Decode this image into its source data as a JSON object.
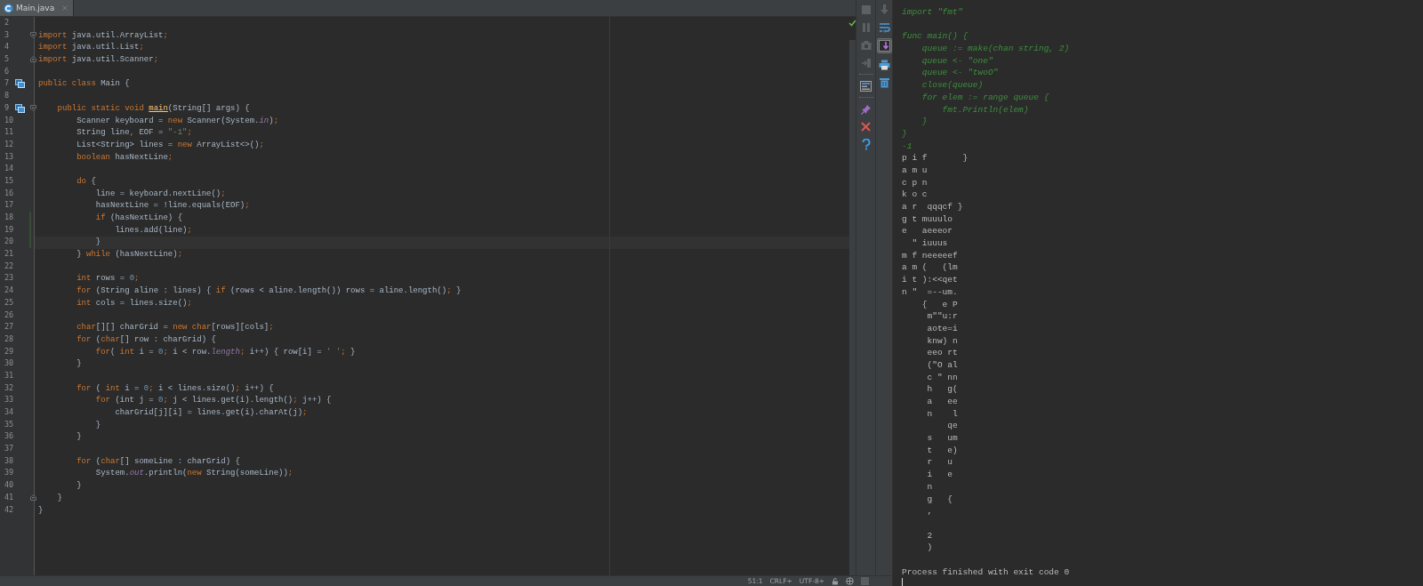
{
  "editor": {
    "tabs": [
      {
        "label": "Main.java",
        "selected": true
      }
    ],
    "inspection_ok": true,
    "lines": [
      {
        "number": "2"
      },
      {
        "number": "3",
        "fold_start": true,
        "tokens": [
          {
            "kind": "keyword",
            "text": "import"
          },
          {
            "kind": "plain",
            "text": " java.util.ArrayList"
          },
          {
            "kind": "punct",
            "text": ";"
          }
        ]
      },
      {
        "number": "4",
        "tokens": [
          {
            "kind": "keyword",
            "text": "import"
          },
          {
            "kind": "plain",
            "text": " java.util.List"
          },
          {
            "kind": "punct",
            "text": ";"
          }
        ]
      },
      {
        "number": "5",
        "fold_end": true,
        "tokens": [
          {
            "kind": "keyword",
            "text": "import"
          },
          {
            "kind": "plain",
            "text": " java.util.Scanner"
          },
          {
            "kind": "punct",
            "text": ";"
          }
        ]
      },
      {
        "number": "6"
      },
      {
        "number": "7",
        "has_implementations": true,
        "tokens": [
          {
            "kind": "keyword",
            "text": "public class"
          },
          {
            "kind": "plain",
            "text": " Main {"
          }
        ]
      },
      {
        "number": "8"
      },
      {
        "number": "9",
        "has_implementations": true,
        "fold_start": true,
        "tokens": [
          {
            "kind": "keyword",
            "text": "    public static void "
          },
          {
            "kind": "method",
            "text": "main"
          },
          {
            "kind": "plain",
            "text": "(String[] args) {"
          }
        ]
      },
      {
        "number": "10",
        "tokens": [
          {
            "kind": "plain",
            "text": "        Scanner keyboard = "
          },
          {
            "kind": "keyword",
            "text": "new"
          },
          {
            "kind": "plain",
            "text": " Scanner(System."
          },
          {
            "kind": "field",
            "text": "in"
          },
          {
            "kind": "plain",
            "text": ")"
          },
          {
            "kind": "punct",
            "text": ";"
          }
        ]
      },
      {
        "number": "11",
        "tokens": [
          {
            "kind": "plain",
            "text": "        String line"
          },
          {
            "kind": "punct",
            "text": ","
          },
          {
            "kind": "plain",
            "text": " EOF = "
          },
          {
            "kind": "string",
            "text": "\"-1\""
          },
          {
            "kind": "punct",
            "text": ";"
          }
        ]
      },
      {
        "number": "12",
        "tokens": [
          {
            "kind": "plain",
            "text": "        List<String> lines = "
          },
          {
            "kind": "keyword",
            "text": "new"
          },
          {
            "kind": "plain",
            "text": " ArrayList<>()"
          },
          {
            "kind": "punct",
            "text": ";"
          }
        ]
      },
      {
        "number": "13",
        "tokens": [
          {
            "kind": "keyword",
            "text": "        boolean"
          },
          {
            "kind": "plain",
            "text": " hasNextLine"
          },
          {
            "kind": "punct",
            "text": ";"
          }
        ]
      },
      {
        "number": "14"
      },
      {
        "number": "15",
        "tokens": [
          {
            "kind": "keyword",
            "text": "        do"
          },
          {
            "kind": "plain",
            "text": " {"
          }
        ]
      },
      {
        "number": "16",
        "tokens": [
          {
            "kind": "plain",
            "text": "            line = keyboard.nextLine()"
          },
          {
            "kind": "punct",
            "text": ";"
          }
        ]
      },
      {
        "number": "17",
        "tokens": [
          {
            "kind": "plain",
            "text": "            hasNextLine = !line.equals(EOF)"
          },
          {
            "kind": "punct",
            "text": ";"
          }
        ]
      },
      {
        "number": "18",
        "changed": true,
        "tokens": [
          {
            "kind": "keyword",
            "text": "            if"
          },
          {
            "kind": "plain",
            "text": " (hasNextLine) {"
          }
        ]
      },
      {
        "number": "19",
        "changed": true,
        "tokens": [
          {
            "kind": "plain",
            "text": "                lines.add(line)"
          },
          {
            "kind": "punct",
            "text": ";"
          }
        ]
      },
      {
        "number": "20",
        "changed": true,
        "current": true,
        "tokens": [
          {
            "kind": "plain",
            "text": "            }"
          }
        ]
      },
      {
        "number": "21",
        "tokens": [
          {
            "kind": "plain",
            "text": "        } "
          },
          {
            "kind": "keyword",
            "text": "while"
          },
          {
            "kind": "plain",
            "text": " (hasNextLine)"
          },
          {
            "kind": "punct",
            "text": ";"
          }
        ]
      },
      {
        "number": "22"
      },
      {
        "number": "23",
        "tokens": [
          {
            "kind": "keyword",
            "text": "        int"
          },
          {
            "kind": "plain",
            "text": " rows = "
          },
          {
            "kind": "number",
            "text": "0"
          },
          {
            "kind": "punct",
            "text": ";"
          }
        ]
      },
      {
        "number": "24",
        "tokens": [
          {
            "kind": "keyword",
            "text": "        for"
          },
          {
            "kind": "plain",
            "text": " (String aline : lines) { "
          },
          {
            "kind": "keyword",
            "text": "if"
          },
          {
            "kind": "plain",
            "text": " (rows < aline.length()) rows = aline.length()"
          },
          {
            "kind": "punct",
            "text": ";"
          },
          {
            "kind": "plain",
            "text": " }"
          }
        ]
      },
      {
        "number": "25",
        "tokens": [
          {
            "kind": "keyword",
            "text": "        int"
          },
          {
            "kind": "plain",
            "text": " cols = lines.size()"
          },
          {
            "kind": "punct",
            "text": ";"
          }
        ]
      },
      {
        "number": "26"
      },
      {
        "number": "27",
        "tokens": [
          {
            "kind": "keyword",
            "text": "        char"
          },
          {
            "kind": "plain",
            "text": "[][] charGrid = "
          },
          {
            "kind": "keyword",
            "text": "new char"
          },
          {
            "kind": "plain",
            "text": "[rows][cols]"
          },
          {
            "kind": "punct",
            "text": ";"
          }
        ]
      },
      {
        "number": "28",
        "tokens": [
          {
            "kind": "keyword",
            "text": "        for"
          },
          {
            "kind": "plain",
            "text": " ("
          },
          {
            "kind": "keyword",
            "text": "char"
          },
          {
            "kind": "plain",
            "text": "[] row : charGrid) {"
          }
        ]
      },
      {
        "number": "29",
        "tokens": [
          {
            "kind": "keyword",
            "text": "            for"
          },
          {
            "kind": "plain",
            "text": "( "
          },
          {
            "kind": "keyword",
            "text": "int"
          },
          {
            "kind": "plain",
            "text": " i = "
          },
          {
            "kind": "number",
            "text": "0"
          },
          {
            "kind": "punct",
            "text": ";"
          },
          {
            "kind": "plain",
            "text": " i < row."
          },
          {
            "kind": "field",
            "text": "length"
          },
          {
            "kind": "punct",
            "text": ";"
          },
          {
            "kind": "plain",
            "text": " i++) { row[i] = "
          },
          {
            "kind": "string",
            "text": "' '"
          },
          {
            "kind": "punct",
            "text": ";"
          },
          {
            "kind": "plain",
            "text": " }"
          }
        ]
      },
      {
        "number": "30",
        "tokens": [
          {
            "kind": "plain",
            "text": "        }"
          }
        ]
      },
      {
        "number": "31"
      },
      {
        "number": "32",
        "tokens": [
          {
            "kind": "keyword",
            "text": "        for"
          },
          {
            "kind": "plain",
            "text": " ( "
          },
          {
            "kind": "keyword",
            "text": "int"
          },
          {
            "kind": "plain",
            "text": " i = "
          },
          {
            "kind": "number",
            "text": "0"
          },
          {
            "kind": "punct",
            "text": ";"
          },
          {
            "kind": "plain",
            "text": " i < lines.size()"
          },
          {
            "kind": "punct",
            "text": ";"
          },
          {
            "kind": "plain",
            "text": " i++) {"
          }
        ]
      },
      {
        "number": "33",
        "tokens": [
          {
            "kind": "keyword",
            "text": "            for"
          },
          {
            "kind": "plain",
            "text": " (int j = "
          },
          {
            "kind": "number",
            "text": "0"
          },
          {
            "kind": "punct",
            "text": ";"
          },
          {
            "kind": "plain",
            "text": " j < lines.get(i).length()"
          },
          {
            "kind": "punct",
            "text": ";"
          },
          {
            "kind": "plain",
            "text": " j++) {"
          }
        ]
      },
      {
        "number": "34",
        "tokens": [
          {
            "kind": "plain",
            "text": "                charGrid[j][i] = lines.get(i).charAt(j)"
          },
          {
            "kind": "punct",
            "text": ";"
          }
        ]
      },
      {
        "number": "35",
        "tokens": [
          {
            "kind": "plain",
            "text": "            }"
          }
        ]
      },
      {
        "number": "36",
        "tokens": [
          {
            "kind": "plain",
            "text": "        }"
          }
        ]
      },
      {
        "number": "37"
      },
      {
        "number": "38",
        "tokens": [
          {
            "kind": "keyword",
            "text": "        for"
          },
          {
            "kind": "plain",
            "text": " ("
          },
          {
            "kind": "keyword",
            "text": "char"
          },
          {
            "kind": "plain",
            "text": "[] someLine : charGrid) {"
          }
        ]
      },
      {
        "number": "39",
        "tokens": [
          {
            "kind": "plain",
            "text": "            System."
          },
          {
            "kind": "field",
            "text": "out"
          },
          {
            "kind": "plain",
            "text": ".println("
          },
          {
            "kind": "keyword",
            "text": "new"
          },
          {
            "kind": "plain",
            "text": " String(someLine))"
          },
          {
            "kind": "punct",
            "text": ";"
          }
        ]
      },
      {
        "number": "40",
        "tokens": [
          {
            "kind": "plain",
            "text": "        }"
          }
        ]
      },
      {
        "number": "41",
        "fold_end": true,
        "tokens": [
          {
            "kind": "plain",
            "text": "    }"
          }
        ]
      },
      {
        "number": "42",
        "tokens": [
          {
            "kind": "plain",
            "text": "}"
          }
        ]
      }
    ]
  },
  "tool_strips": [
    {
      "buttons": [
        {
          "kind": "stop",
          "disabled": true
        },
        {
          "kind": "pause",
          "disabled": true
        },
        {
          "kind": "camera",
          "disabled": true
        },
        {
          "kind": "login",
          "disabled": true
        },
        {
          "kind": "separator"
        },
        {
          "kind": "layout",
          "disabled": false
        },
        {
          "kind": "separator"
        },
        {
          "kind": "pin",
          "disabled": false
        },
        {
          "kind": "close",
          "disabled": false
        },
        {
          "kind": "help",
          "disabled": false
        }
      ]
    },
    {
      "buttons": [
        {
          "kind": "down",
          "disabled": true,
          "selected": false
        },
        {
          "kind": "wrap",
          "disabled": false,
          "selected": false
        },
        {
          "kind": "scroll-end",
          "disabled": false,
          "selected": true
        },
        {
          "kind": "print",
          "disabled": false,
          "selected": false
        },
        {
          "kind": "trash",
          "disabled": false,
          "selected": false
        }
      ]
    }
  ],
  "status_bar": {
    "position": "51:1",
    "line_separator": "CRLF÷",
    "encoding": "UTF-8÷"
  },
  "console": {
    "caret": true,
    "lines": [
      {
        "kind": "echo",
        "text": "import \"fmt\""
      },
      {
        "kind": "blank"
      },
      {
        "kind": "echo",
        "text": "func main() {"
      },
      {
        "kind": "echo",
        "text": "    queue := make(chan string, 2)"
      },
      {
        "kind": "echo",
        "text": "    queue <- \"one\""
      },
      {
        "kind": "echo",
        "text": "    queue <- \"twoO\""
      },
      {
        "kind": "echo",
        "text": "    close(queue)"
      },
      {
        "kind": "echo",
        "text": "    for elem := range queue {"
      },
      {
        "kind": "echo",
        "text": "        fmt.Println(elem)"
      },
      {
        "kind": "echo",
        "text": "    }"
      },
      {
        "kind": "echo",
        "text": "}"
      },
      {
        "kind": "echo",
        "text": "-1"
      },
      {
        "kind": "output",
        "text": "p i f       }"
      },
      {
        "kind": "output",
        "text": "a m u"
      },
      {
        "kind": "output",
        "text": "c p n"
      },
      {
        "kind": "output",
        "text": "k o c"
      },
      {
        "kind": "output",
        "text": "a r  qqqcf }"
      },
      {
        "kind": "output",
        "text": "g t muuulo"
      },
      {
        "kind": "output",
        "text": "e   aeeeor"
      },
      {
        "kind": "output",
        "text": "  \" iuuus"
      },
      {
        "kind": "output",
        "text": "m f neeeeef"
      },
      {
        "kind": "output",
        "text": "a m (   (lm"
      },
      {
        "kind": "output",
        "text": "i t ):<<qet"
      },
      {
        "kind": "output",
        "text": "n \"  =--um."
      },
      {
        "kind": "output",
        "text": "    {   e P"
      },
      {
        "kind": "output",
        "text": "     m\"\"u:r"
      },
      {
        "kind": "output",
        "text": "     aote=i"
      },
      {
        "kind": "output",
        "text": "     knw) n"
      },
      {
        "kind": "output",
        "text": "     eeo rt"
      },
      {
        "kind": "output",
        "text": "     (\"O al"
      },
      {
        "kind": "output",
        "text": "     c \" nn"
      },
      {
        "kind": "output",
        "text": "     h   g("
      },
      {
        "kind": "output",
        "text": "     a   ee"
      },
      {
        "kind": "output",
        "text": "     n    l"
      },
      {
        "kind": "output",
        "text": "         qe"
      },
      {
        "kind": "output",
        "text": "     s   um"
      },
      {
        "kind": "output",
        "text": "     t   e)"
      },
      {
        "kind": "output",
        "text": "     r   u"
      },
      {
        "kind": "output",
        "text": "     i   e"
      },
      {
        "kind": "output",
        "text": "     n"
      },
      {
        "kind": "output",
        "text": "     g   {"
      },
      {
        "kind": "output",
        "text": "     ,"
      },
      {
        "kind": "blank"
      },
      {
        "kind": "output",
        "text": "     2"
      },
      {
        "kind": "output",
        "text": "     )"
      },
      {
        "kind": "blank"
      },
      {
        "kind": "output",
        "text": "Process finished with exit code 0"
      }
    ]
  }
}
